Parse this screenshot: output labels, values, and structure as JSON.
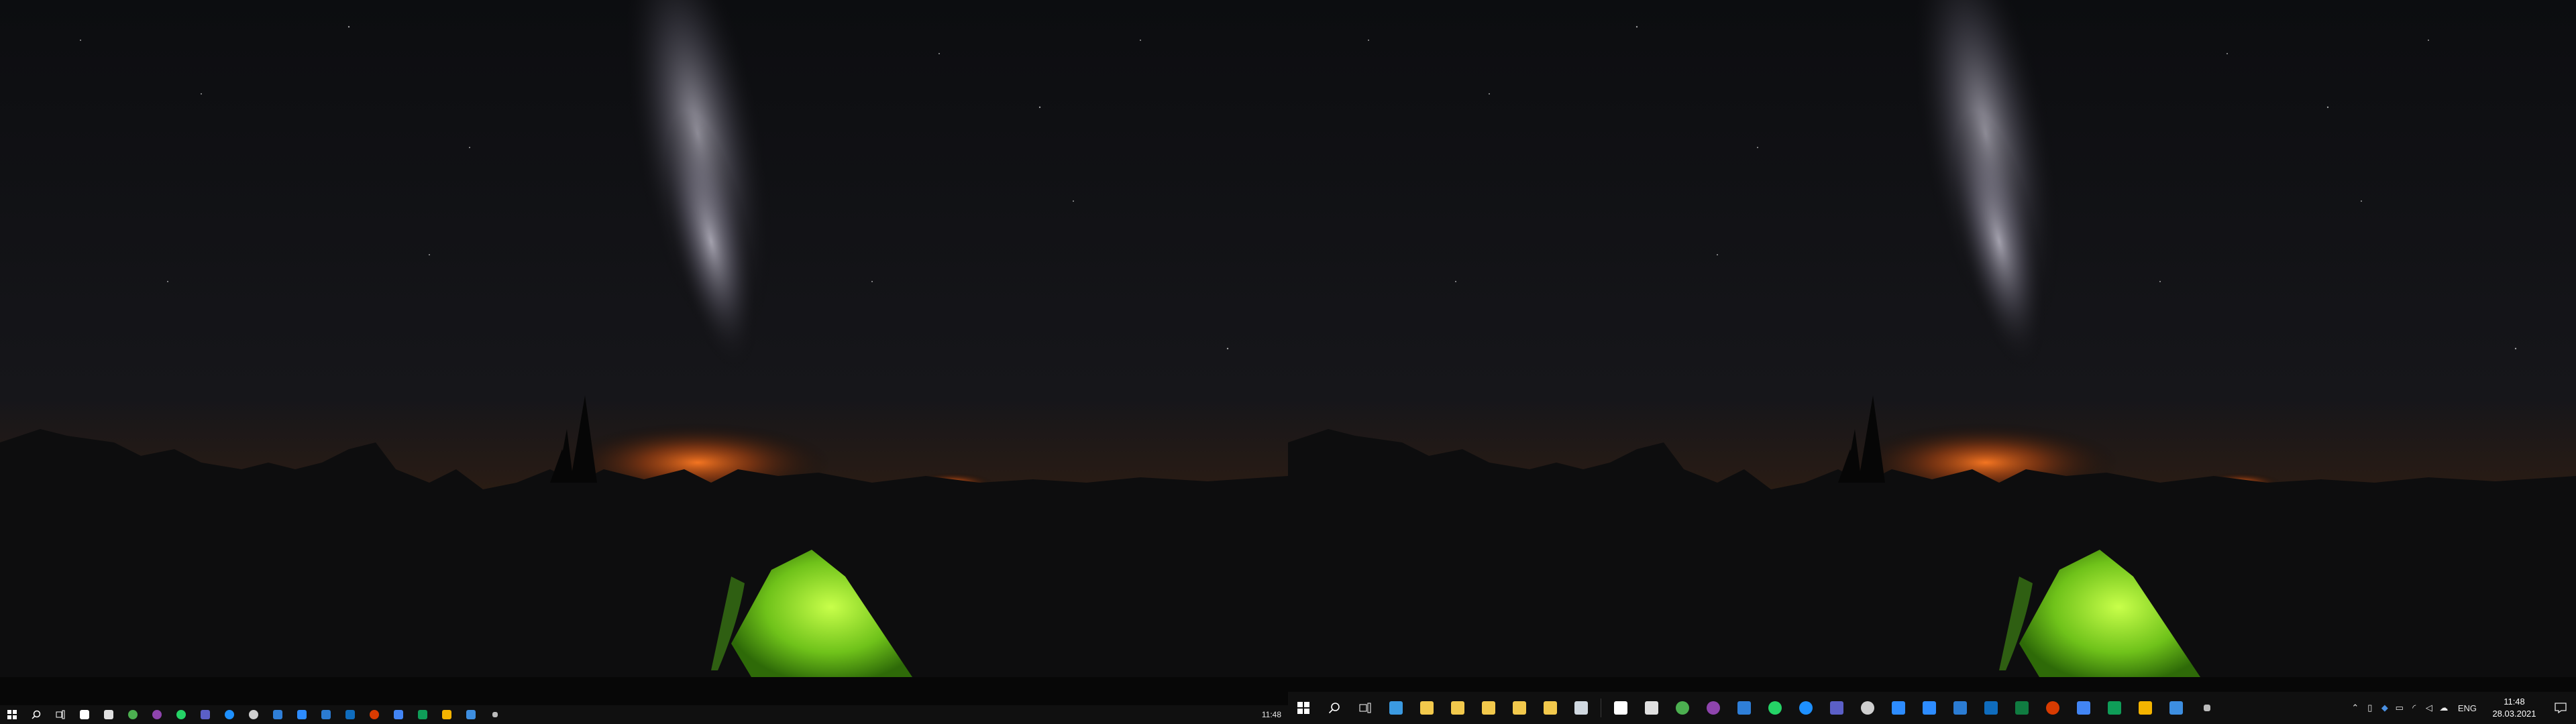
{
  "left_taskbar": {
    "time": "11:48",
    "icons": [
      {
        "name": "start-icon",
        "color": "#ffffff"
      },
      {
        "name": "search-icon",
        "color": "#ffffff"
      },
      {
        "name": "task-view-icon",
        "color": "#ffffff"
      },
      {
        "name": "store-icon",
        "color": "#ffffff"
      },
      {
        "name": "pen-app-icon",
        "color": "#e0e0e0"
      },
      {
        "name": "chrome-icon",
        "color": "#4caf50"
      },
      {
        "name": "purple-app-icon",
        "color": "#8e44ad"
      },
      {
        "name": "whatsapp-icon",
        "color": "#25d366"
      },
      {
        "name": "teams-icon",
        "color": "#5b5fc7"
      },
      {
        "name": "chat-icon",
        "color": "#1e90ff"
      },
      {
        "name": "clock-app-icon",
        "color": "#cfcfcf"
      },
      {
        "name": "app-icon",
        "color": "#2f7fd8"
      },
      {
        "name": "zoom-icon",
        "color": "#2d8cff"
      },
      {
        "name": "word-icon",
        "color": "#2b7cd3"
      },
      {
        "name": "outlook-icon",
        "color": "#0f6cbd"
      },
      {
        "name": "office-icon",
        "color": "#d83b01"
      },
      {
        "name": "docs-icon",
        "color": "#4285f4"
      },
      {
        "name": "sheets-icon",
        "color": "#0f9d58"
      },
      {
        "name": "keep-icon",
        "color": "#f4b400"
      },
      {
        "name": "check-app-icon",
        "color": "#3d8ee0"
      },
      {
        "name": "tray-arrow-icon",
        "color": "#bbbbbb"
      }
    ]
  },
  "right_taskbar": {
    "time": "11:48",
    "date": "28.03.2021",
    "language": "ENG",
    "system_buttons": [
      {
        "name": "start-icon"
      },
      {
        "name": "search-icon"
      },
      {
        "name": "task-view-icon"
      }
    ],
    "pinned_icons": [
      {
        "name": "this-pc-icon",
        "color": "#3b9ae1"
      },
      {
        "name": "folder-icon",
        "color": "#f2c94c"
      },
      {
        "name": "folder-users-icon",
        "color": "#f2c94c"
      },
      {
        "name": "folder-star-icon",
        "color": "#f2c94c"
      },
      {
        "name": "folder-docs-icon",
        "color": "#f2c94c"
      },
      {
        "name": "folder-icon",
        "color": "#f2c94c"
      },
      {
        "name": "recycle-bin-icon",
        "color": "#d0d8e0"
      }
    ],
    "app_icons": [
      {
        "name": "store-icon",
        "color": "#ffffff"
      },
      {
        "name": "pen-app-icon",
        "color": "#e0e0e0"
      },
      {
        "name": "chrome-icon",
        "color": "#4caf50"
      },
      {
        "name": "purple-app-icon",
        "color": "#8e44ad"
      },
      {
        "name": "app-icon",
        "color": "#2f7fd8"
      },
      {
        "name": "whatsapp-icon",
        "color": "#25d366"
      },
      {
        "name": "chat-icon",
        "color": "#1e90ff"
      },
      {
        "name": "teams-icon",
        "color": "#5b5fc7"
      },
      {
        "name": "clock-app-icon",
        "color": "#cfcfcf"
      },
      {
        "name": "app-icon",
        "color": "#2d8cff"
      },
      {
        "name": "zoom-icon",
        "color": "#2d8cff"
      },
      {
        "name": "word-icon",
        "color": "#2b7cd3"
      },
      {
        "name": "outlook-icon",
        "color": "#0f6cbd"
      },
      {
        "name": "excel-icon",
        "color": "#107c41"
      },
      {
        "name": "office-icon",
        "color": "#d83b01"
      },
      {
        "name": "docs-icon",
        "color": "#4285f4"
      },
      {
        "name": "sheets-icon",
        "color": "#0f9d58"
      },
      {
        "name": "keep-icon",
        "color": "#f4b400"
      },
      {
        "name": "check-app-icon",
        "color": "#3d8ee0"
      },
      {
        "name": "tray-arrow-icon",
        "color": "#bbbbbb"
      }
    ],
    "tray_icons": [
      {
        "name": "chevron-up-icon",
        "glyph": "⌃"
      },
      {
        "name": "device-icon",
        "glyph": "▯"
      },
      {
        "name": "dropbox-icon",
        "glyph": "◆"
      },
      {
        "name": "battery-icon",
        "glyph": "▭"
      },
      {
        "name": "network-icon",
        "glyph": "◜"
      },
      {
        "name": "volume-icon",
        "glyph": "◁"
      },
      {
        "name": "onedrive-icon",
        "glyph": "☁"
      }
    ]
  }
}
